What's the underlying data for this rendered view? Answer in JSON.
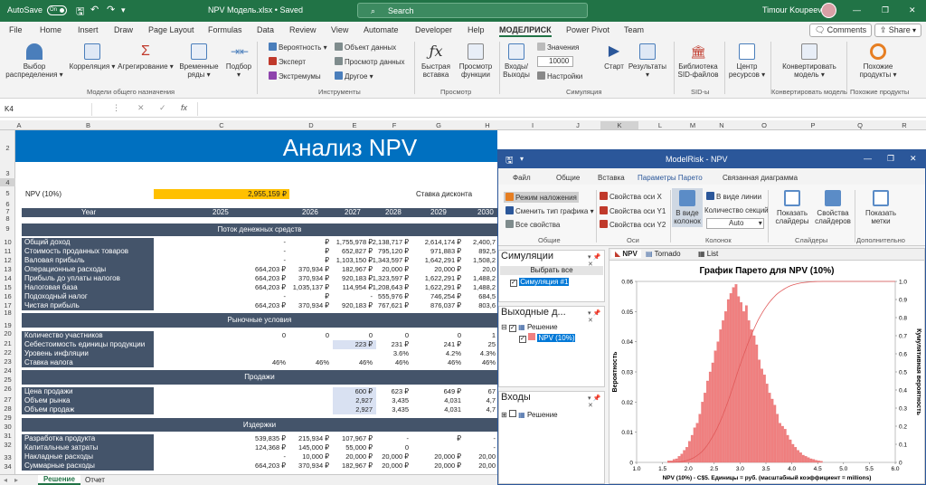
{
  "titlebar": {
    "autosave": "AutoSave",
    "toggle": "On",
    "filename": "NPV Модель.xlsx • Saved",
    "search": "Search",
    "user": "Timour Koupeev"
  },
  "menu": {
    "items": [
      "File",
      "Home",
      "Insert",
      "Draw",
      "Page Layout",
      "Formulas",
      "Data",
      "Review",
      "View",
      "Automate",
      "Developer",
      "Help",
      "МОДЕЛРИСК",
      "Power Pivot",
      "Team"
    ],
    "comments": "Comments",
    "share": "Share"
  },
  "ribbon": {
    "distribution_choice": "Выбор распределения",
    "correlation": "Корреляция",
    "aggregation": "Агрегирование",
    "time_series": "Временные ряды",
    "fit": "Подбор",
    "probability": "Вероятность",
    "expert": "Эксперт",
    "extremes": "Экстремумы",
    "data_object": "Объект данных",
    "data_view": "Просмотр данных",
    "other": "Другое",
    "quick_insert": "Быстрая вставка",
    "view_function": "Просмотр функции",
    "inputs_outputs": "Входы/ Выходы",
    "values": "Значения",
    "iterations": "10000",
    "settings": "Настройки",
    "start": "Старт",
    "results": "Результаты",
    "sid_library": "Библиотека SID-файлов",
    "resource_center": "Центр ресурсов",
    "convert_model": "Конвертировать модель",
    "similar_products": "Похожие продукты",
    "groups": [
      "Модели общего назначения",
      "Инструменты",
      "Просмотр",
      "Симуляция",
      "SID-ы",
      "Конвертировать модель",
      "Похожие продукты"
    ]
  },
  "formula_bar": {
    "name_box": "K4",
    "fx": "fx"
  },
  "columns": [
    "A",
    "B",
    "C",
    "D",
    "E",
    "F",
    "G",
    "H",
    "I",
    "J",
    "K",
    "L",
    "M",
    "N",
    "O",
    "P",
    "Q",
    "R"
  ],
  "rows": [
    "2",
    "3",
    "4",
    "5",
    "6",
    "7",
    "8",
    "9",
    "10",
    "11",
    "12",
    "13",
    "14",
    "15",
    "16",
    "17",
    "18",
    "19",
    "20",
    "21",
    "22",
    "23",
    "24",
    "25",
    "26",
    "27",
    "28",
    "29",
    "30",
    "31",
    "32",
    "33",
    "34"
  ],
  "sheet": {
    "title": "Анализ NPV",
    "npv_label": "NPV (10%)",
    "npv_value": "2,955,159 ₽",
    "discount_label": "Ставка дисконта",
    "year_label": "Year",
    "years": [
      "2025",
      "2026",
      "2027",
      "2028",
      "2029",
      "2030"
    ],
    "sec_cashflow": "Поток денежных средств",
    "sec_market": "Рыночные условия",
    "sec_sales": "Продажи",
    "sec_costs": "Издержки",
    "cashflow_rows": [
      {
        "label": "Общий доход",
        "v": [
          "-",
          "₽",
          "1,755,978 ₽",
          "2,138,717 ₽",
          "2,614,174 ₽",
          "2,400,7"
        ]
      },
      {
        "label": "Стоимость проданных товаров",
        "v": [
          "-",
          "₽",
          "652,827 ₽",
          "795,120 ₽",
          "971,883 ₽",
          "892,5"
        ]
      },
      {
        "label": "Валовая прибыль",
        "v": [
          "-",
          "₽",
          "1,103,150 ₽",
          "1,343,597 ₽",
          "1,642,291 ₽",
          "1,508,2"
        ]
      },
      {
        "label": "Операционные расходы",
        "v": [
          "664,203 ₽",
          "370,934 ₽",
          "182,967 ₽",
          "20,000 ₽",
          "20,000 ₽",
          "20,0"
        ]
      },
      {
        "label": "Прибыль до уплаты налогов",
        "v": [
          "664,203 ₽",
          "370,934 ₽",
          "920,183 ₽",
          "1,323,597 ₽",
          "1,622,291 ₽",
          "1,488,2"
        ]
      },
      {
        "label": "Налоговая база",
        "v": [
          "664,203 ₽",
          "1,035,137 ₽",
          "114,954 ₽",
          "1,208,643 ₽",
          "1,622,291 ₽",
          "1,488,2"
        ]
      },
      {
        "label": "Подоходный налог",
        "v": [
          "-",
          "₽",
          "-",
          "555,976 ₽",
          "746,254 ₽",
          "684,5"
        ]
      },
      {
        "label": "Чистая прибыль",
        "v": [
          "664,203 ₽",
          "370,934 ₽",
          "920,183 ₽",
          "767,621 ₽",
          "876,037 ₽",
          "803,6"
        ]
      }
    ],
    "market_rows": [
      {
        "label": "Количество участников",
        "v": [
          "0",
          "0",
          "0",
          "0",
          "0",
          "1"
        ]
      },
      {
        "label": "Себестоимость единицы продукции",
        "v": [
          "",
          "",
          "223 ₽",
          "231 ₽",
          "241 ₽",
          "25"
        ]
      },
      {
        "label": "Уровень инфляции",
        "v": [
          "",
          "",
          "",
          "3.6%",
          "4.2%",
          "4.3%"
        ]
      },
      {
        "label": "Ставка налога",
        "v": [
          "46%",
          "46%",
          "46%",
          "46%",
          "46%",
          "46%"
        ]
      }
    ],
    "sales_rows": [
      {
        "label": "Цена продажи",
        "v": [
          "",
          "",
          "600 ₽",
          "623 ₽",
          "649 ₽",
          "67"
        ]
      },
      {
        "label": "Объем рынка",
        "v": [
          "",
          "",
          "2,927",
          "3,435",
          "4,031",
          "4,7"
        ]
      },
      {
        "label": "Объем продаж",
        "v": [
          "",
          "",
          "2,927",
          "3,435",
          "4,031",
          "4,7"
        ]
      }
    ],
    "cost_rows": [
      {
        "label": "Разработка продукта",
        "v": [
          "539,835 ₽",
          "215,934 ₽",
          "107,967 ₽",
          "-",
          "₽",
          "-"
        ]
      },
      {
        "label": "Капитальные затраты",
        "v": [
          "124,368 ₽",
          "145,000 ₽",
          "55,000 ₽",
          "0",
          "",
          "-"
        ]
      },
      {
        "label": "Накладные расходы",
        "v": [
          "-",
          "10,000 ₽",
          "20,000 ₽",
          "20,000 ₽",
          "20,000 ₽",
          "20,00"
        ]
      },
      {
        "label": "Суммарные расходы",
        "v": [
          "664,203 ₽",
          "370,934 ₽",
          "182,967 ₽",
          "20,000 ₽",
          "20,000 ₽",
          "20,00"
        ]
      }
    ]
  },
  "sheet_tabs": [
    "Решение",
    "Отчет"
  ],
  "modelrisk": {
    "title": "ModelRisk - NPV",
    "tabs": [
      "Файл",
      "Общие",
      "Вставка",
      "Параметры Парето",
      "Связанная диаграмма"
    ],
    "overlay_mode": "Режим наложения",
    "change_chart_type": "Сменить тип графика",
    "all_properties": "Все свойства",
    "grp_general": "Общие",
    "axis_x": "Свойства оси X",
    "axis_y1": "Свойства оси Y1",
    "axis_y2": "Свойства оси Y2",
    "grp_axes": "Оси",
    "as_columns": "В виде колонок",
    "as_line": "В виде линии",
    "sections_count": "Количество секций",
    "auto": "Auto",
    "grp_columns": "Колонок",
    "show_sliders": "Показать слайдеры",
    "slider_props": "Свойства слайдеров",
    "grp_sliders": "Слайдеры",
    "show_labels": "Показать метки",
    "grp_extra": "Дополнительно",
    "sim_panel": "Симуляции",
    "select_all": "Выбрать все",
    "sim1": "Симуляция #1",
    "outputs_panel": "Выходные д...",
    "solution": "Решение",
    "npv_output": "NPV (10%)",
    "inputs_panel": "Входы",
    "chart_tabs": [
      "NPV",
      "Tornado",
      "List"
    ]
  },
  "chart_data": {
    "type": "bar",
    "title": "График Парето для NPV (10%)",
    "xlabel": "NPV (10%) - C$5.  Единицы = руб. (масштабный коэффициент = millions)",
    "ylabel": "Вероятность",
    "y2label": "Кумулятивная вероятность",
    "xlim": [
      1.0,
      6.0
    ],
    "ylim": [
      0,
      0.06
    ],
    "y2lim": [
      0,
      1.0
    ],
    "xticks": [
      "1.0",
      "1.5",
      "2.0",
      "2.5",
      "3.0",
      "3.5",
      "4.0",
      "4.5",
      "5.0",
      "5.5",
      "6.0"
    ],
    "yticks": [
      "0",
      "0.01",
      "0.02",
      "0.03",
      "0.04",
      "0.05",
      "0.06"
    ],
    "y2ticks": [
      "0",
      "0.1",
      "0.2",
      "0.3",
      "0.4",
      "0.5",
      "0.6",
      "0.7",
      "0.8",
      "0.9",
      "1.0"
    ],
    "bins_start": 1.6,
    "bin_width": 0.05,
    "values": [
      0.0005,
      0.0005,
      0.001,
      0.0012,
      0.002,
      0.0028,
      0.004,
      0.005,
      0.007,
      0.009,
      0.0115,
      0.013,
      0.016,
      0.02,
      0.023,
      0.027,
      0.03,
      0.033,
      0.037,
      0.04,
      0.044,
      0.047,
      0.05,
      0.054,
      0.056,
      0.058,
      0.059,
      0.055,
      0.053,
      0.05,
      0.052,
      0.047,
      0.044,
      0.042,
      0.039,
      0.034,
      0.031,
      0.029,
      0.026,
      0.023,
      0.021,
      0.019,
      0.016,
      0.013,
      0.012,
      0.011,
      0.009,
      0.0075,
      0.006,
      0.005,
      0.004,
      0.0032,
      0.0024,
      0.002,
      0.0016,
      0.0012,
      0.001,
      0.0007,
      0.0005,
      0.0004
    ],
    "bar_color": "#f08080",
    "line_color": "#e05a5a"
  }
}
